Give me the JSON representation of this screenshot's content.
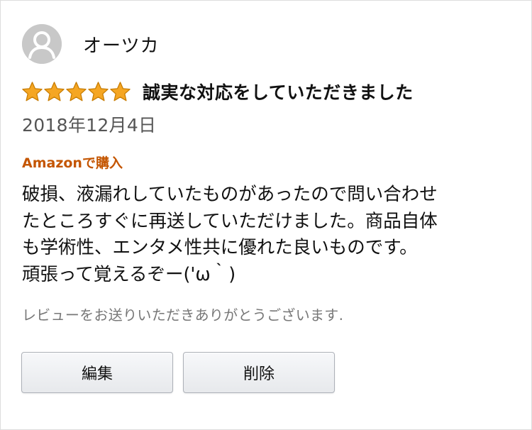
{
  "review": {
    "user_name": "オーツカ",
    "rating": 5,
    "rating_max": 5,
    "title": "誠実な対応をしていただきました",
    "date": "2018年12月4日",
    "purchase_badge": "Amazonで購入",
    "body": "破損、液漏れしていたものがあったので問い合わせ\nたところすぐに再送していただけました。商品自体\nも学術性、エンタメ性共に優れた良いものです。\n頑張って覚えるぞー('ω｀)",
    "thanks_message": "レビューをお送りいただきありがとうございます."
  },
  "actions": {
    "edit_label": "編集",
    "delete_label": "削除"
  },
  "icons": {
    "avatar": "user-avatar-icon",
    "star": "star-icon"
  },
  "colors": {
    "star_fill": "#f5a623",
    "star_stroke": "#c77c02",
    "badge": "#c45500",
    "muted_text": "#777777",
    "date_text": "#555555"
  }
}
